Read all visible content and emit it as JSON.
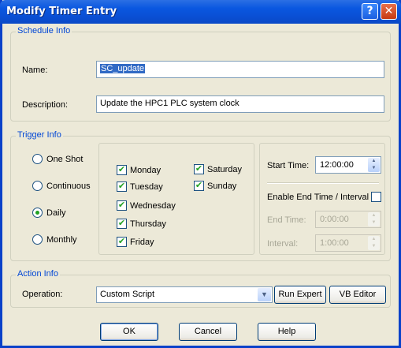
{
  "window": {
    "title": "Modify Timer Entry",
    "help_glyph": "?",
    "close_glyph": "✕"
  },
  "schedule_info": {
    "group_label": "Schedule Info",
    "name_label": "Name:",
    "name_value": "SC_update",
    "description_label": "Description:",
    "description_value": "Update the HPC1 PLC system clock"
  },
  "trigger_info": {
    "group_label": "Trigger Info",
    "modes": [
      {
        "label": "One Shot",
        "selected": false
      },
      {
        "label": "Continuous",
        "selected": false
      },
      {
        "label": "Daily",
        "selected": true
      },
      {
        "label": "Monthly",
        "selected": false
      }
    ],
    "days": [
      {
        "label": "Monday",
        "checked": true
      },
      {
        "label": "Tuesday",
        "checked": true
      },
      {
        "label": "Wednesday",
        "checked": true
      },
      {
        "label": "Thursday",
        "checked": true
      },
      {
        "label": "Friday",
        "checked": true
      },
      {
        "label": "Saturday",
        "checked": true
      },
      {
        "label": "Sunday",
        "checked": true
      }
    ],
    "start_time_label": "Start Time:",
    "start_time_value": "12:00:00",
    "enable_end_label": "Enable End Time / Interval",
    "enable_end_checked": false,
    "end_time_label": "End Time:",
    "end_time_value": "0:00:00",
    "interval_label": "Interval:",
    "interval_value": "1:00:00"
  },
  "action_info": {
    "group_label": "Action Info",
    "operation_label": "Operation:",
    "operation_value": "Custom Script",
    "run_expert_label": "Run Expert",
    "vb_editor_label": "VB Editor"
  },
  "buttons": {
    "ok": "OK",
    "cancel": "Cancel",
    "help": "Help"
  },
  "icons": {
    "check_glyph": "✔",
    "spin_up": "▲",
    "spin_down": "▼",
    "combo_arrow": "▼"
  },
  "colors": {
    "titlebar": "#0a57e0",
    "group_label": "#0046d5",
    "selection": "#316ac5",
    "dialog_bg": "#ece9d8"
  }
}
